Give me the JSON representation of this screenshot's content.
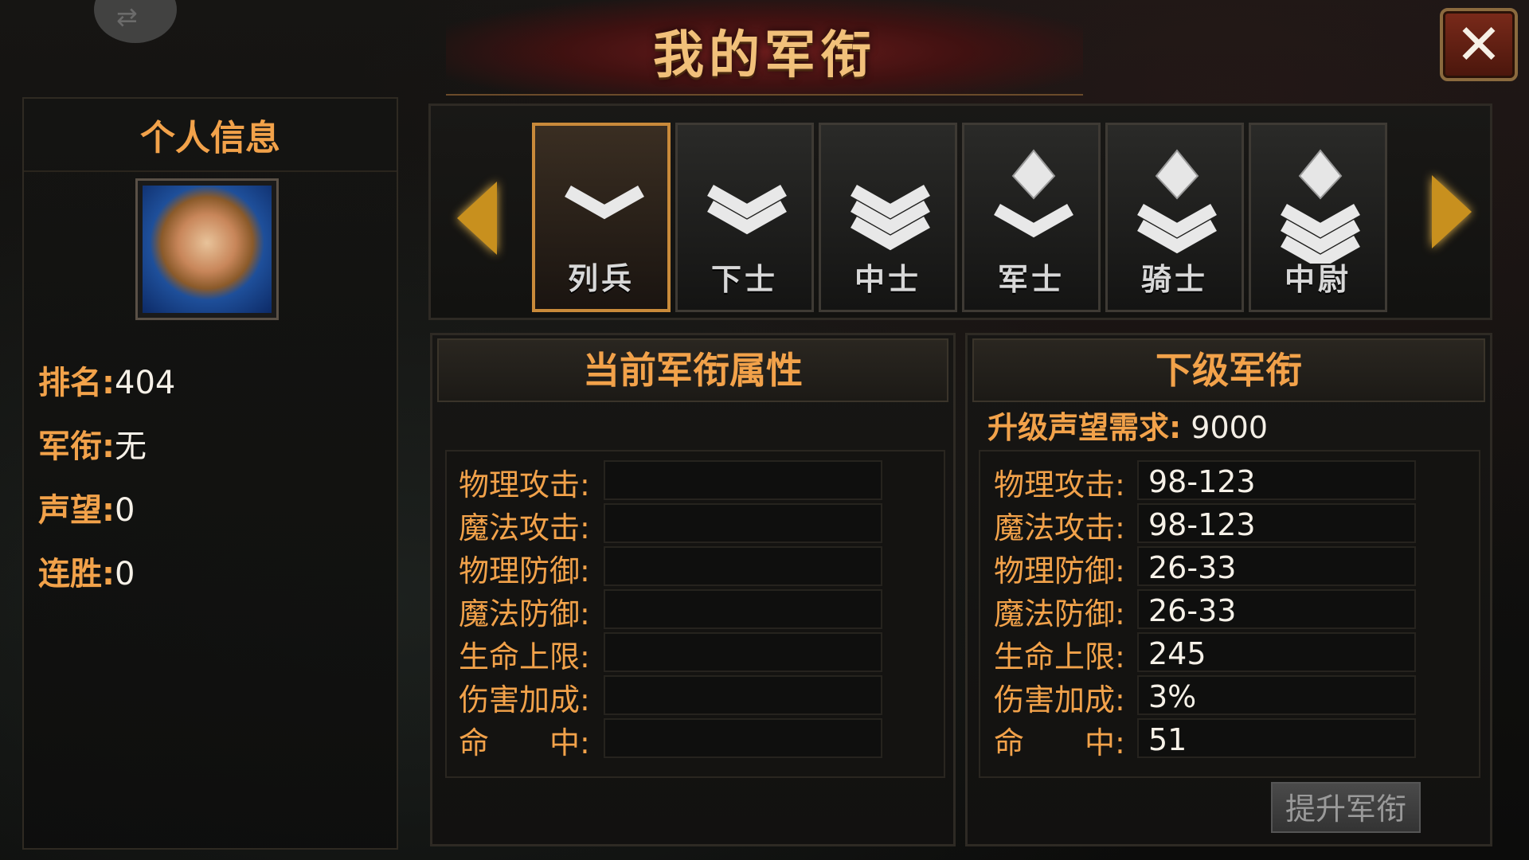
{
  "title": "我的军衔",
  "personal_info": {
    "heading": "个人信息",
    "rows": [
      {
        "label": "排名:",
        "value": "404"
      },
      {
        "label": "军衔:",
        "value": "无"
      },
      {
        "label": "声望:",
        "value": "0"
      },
      {
        "label": "连胜:",
        "value": "0"
      }
    ]
  },
  "ranks": [
    {
      "name": "列兵",
      "chevrons": 1,
      "diamond": false,
      "selected": true
    },
    {
      "name": "下士",
      "chevrons": 2,
      "diamond": false,
      "selected": false
    },
    {
      "name": "中士",
      "chevrons": 3,
      "diamond": false,
      "selected": false
    },
    {
      "name": "军士",
      "chevrons": 1,
      "diamond": true,
      "selected": false
    },
    {
      "name": "骑士",
      "chevrons": 2,
      "diamond": true,
      "selected": false
    },
    {
      "name": "中尉",
      "chevrons": 3,
      "diamond": true,
      "selected": false
    }
  ],
  "current": {
    "heading": "当前军衔属性",
    "stats": [
      {
        "label": "物理攻击:",
        "value": ""
      },
      {
        "label": "魔法攻击:",
        "value": ""
      },
      {
        "label": "物理防御:",
        "value": ""
      },
      {
        "label": "魔法防御:",
        "value": ""
      },
      {
        "label": "生命上限:",
        "value": ""
      },
      {
        "label": "伤害加成:",
        "value": ""
      },
      {
        "label": "命　　中:",
        "value": ""
      }
    ]
  },
  "next": {
    "heading": "下级军衔",
    "requirement_label": "升级声望需求:",
    "requirement_value": "9000",
    "stats": [
      {
        "label": "物理攻击:",
        "value": "98-123"
      },
      {
        "label": "魔法攻击:",
        "value": "98-123"
      },
      {
        "label": "物理防御:",
        "value": "26-33"
      },
      {
        "label": "魔法防御:",
        "value": "26-33"
      },
      {
        "label": "生命上限:",
        "value": "245"
      },
      {
        "label": "伤害加成:",
        "value": "3%"
      },
      {
        "label": "命　　中:",
        "value": "51"
      }
    ]
  },
  "upgrade_button": "提升军衔",
  "icons": {
    "close": "close-icon",
    "back": "swap-icon",
    "prev": "arrow-left-icon",
    "next": "arrow-right-icon"
  },
  "colors": {
    "accent_orange": "#f2a24a",
    "title_gold": "#f1c07a",
    "selected_border": "#c98a3a"
  }
}
